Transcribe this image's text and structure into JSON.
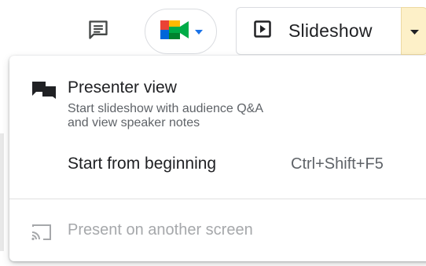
{
  "toolbar": {
    "comment_icon": "comment-icon",
    "meet_icon": "google-meet-icon",
    "meet_dropdown_icon": "caret-down-icon",
    "slideshow_icon": "play-box-icon",
    "slideshow_label": "Slideshow",
    "dropdown_icon": "caret-down-icon"
  },
  "menu": {
    "presenter_view": {
      "icon": "presenter-chat-icon",
      "title": "Presenter view",
      "description_line1": "Start slideshow with audience Q&A",
      "description_line2": "and view speaker notes"
    },
    "start_from_beginning": {
      "label": "Start from beginning",
      "shortcut": "Ctrl+Shift+F5"
    },
    "present_on_another_screen": {
      "icon": "cast-icon",
      "label": "Present on another screen",
      "disabled": true
    }
  },
  "colors": {
    "text_primary": "#202124",
    "text_secondary": "#5f6368",
    "text_disabled": "#a6a8ab",
    "dropdown_highlight": "#fdf0c8",
    "meet_green": "#00832d",
    "meet_blue": "#0066da",
    "meet_yellow": "#ffba00",
    "meet_red": "#e94235"
  }
}
